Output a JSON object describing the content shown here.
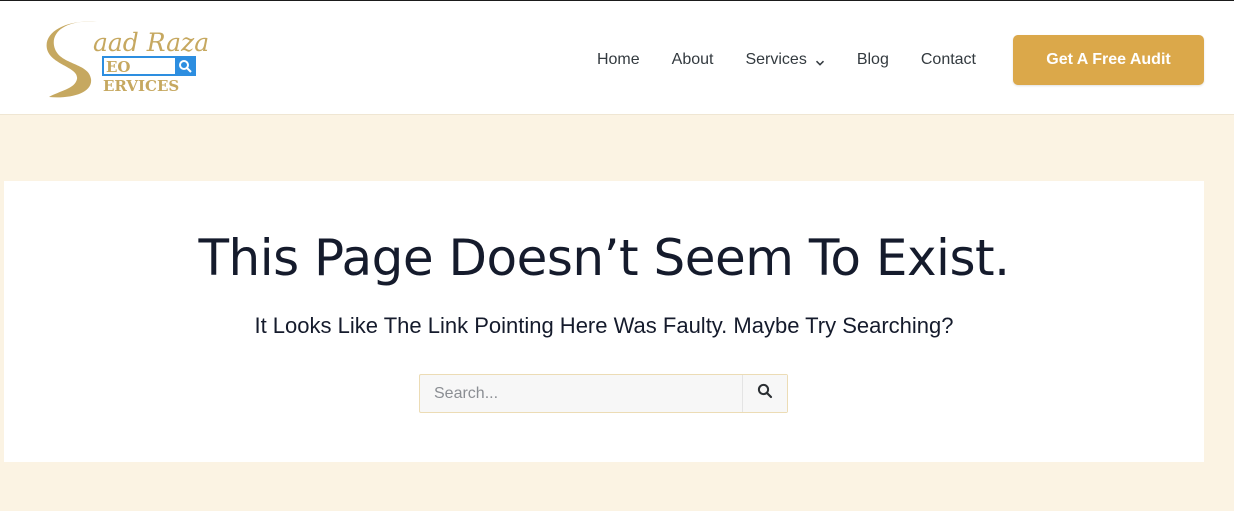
{
  "logo": {
    "script_text": "aad Raza",
    "box_text": "EO",
    "bottom_text": "ERVICES",
    "gold_color": "#c6a860",
    "blue_color": "#2d8ee0"
  },
  "nav": {
    "items": [
      {
        "label": "Home"
      },
      {
        "label": "About"
      },
      {
        "label": "Services",
        "has_dropdown": true
      },
      {
        "label": "Blog"
      },
      {
        "label": "Contact"
      }
    ]
  },
  "cta": {
    "label": "Get A Free Audit",
    "color": "#dba84a"
  },
  "error": {
    "title": "This Page Doesn’t Seem To Exist.",
    "subtitle": "It Looks Like The Link Pointing Here Was Faulty. Maybe Try Searching?"
  },
  "search": {
    "placeholder": "Search...",
    "value": "",
    "button_icon": "search-icon"
  },
  "colors": {
    "page_background": "#fbf3e3",
    "heading": "#151b2c"
  }
}
